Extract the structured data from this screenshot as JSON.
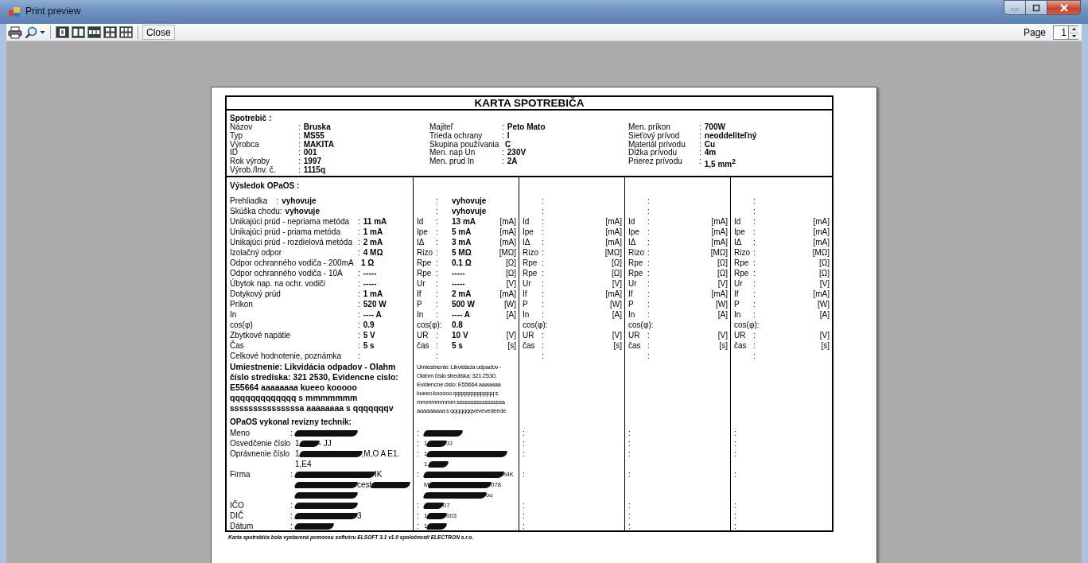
{
  "window": {
    "title": "Print preview"
  },
  "toolbar": {
    "close_button": "Close",
    "page_label": "Page",
    "page": "1"
  },
  "document": {
    "title": "KARTA SPOTREBIČA",
    "appliance": {
      "heading": "Spotrebič :",
      "groups": [
        [
          {
            "label": "Názov",
            "colon": ":",
            "value": "Bruska"
          },
          {
            "label": "Typ",
            "colon": ":",
            "value": "MS55"
          },
          {
            "label": "Výrobca",
            "colon": ":",
            "value": "MAKITA"
          },
          {
            "label": "ID",
            "colon": ":",
            "value": "001"
          },
          {
            "label": "Rok výroby",
            "colon": ":",
            "value": "1997"
          },
          {
            "label": "Výrob./Inv. č.",
            "colon": ":",
            "value": "1115q"
          }
        ],
        [
          {
            "label": "Majiteľ",
            "colon": ":",
            "value": "Peto Mato"
          },
          {
            "label": "Trieda ochrany",
            "colon": ":",
            "value": "I"
          },
          {
            "label": "Skupina používania",
            "value": "C"
          },
          {
            "label": "Men. nap Un",
            "colon": ":",
            "value": "230V"
          },
          {
            "label": "Men. prud In",
            "colon": ":",
            "value": "2A"
          }
        ],
        [
          {
            "label": "Men. príkon",
            "colon": ":",
            "value": "700W"
          },
          {
            "label": "Sieťový prívod",
            "colon": ":",
            "value": "neoddeliteľný"
          },
          {
            "label": "Materiál prívodu",
            "colon": ":",
            "value": "Cu"
          },
          {
            "label": "Dĺžka prívodu",
            "colon": ":",
            "value": "4m"
          },
          {
            "label": "Prierez prívodu",
            "colon": ":",
            "value": "1,5  mm$^{2}$"
          }
        ]
      ]
    },
    "results": {
      "heading": "Výsledok OPaOS :",
      "rows": [
        {
          "kind": "inline",
          "label": "Prehliadka    :",
          "value": "vyhovuje"
        },
        {
          "kind": "inline",
          "label": "Skúška chodu:",
          "value": "vyhovuje"
        },
        {
          "kind": "wide",
          "label": "Unikajúci prúd - nepriama metóda",
          "colon": ":",
          "value": "11 mA"
        },
        {
          "kind": "wide",
          "label": "Unikajúci prúd - priama metóda",
          "colon": ":",
          "value": "1 mA"
        },
        {
          "kind": "wide",
          "label": "Unikajúci prúd - rozdielová metóda",
          "colon": ":",
          "value": "2 mA"
        },
        {
          "kind": "wide",
          "label": "Izolačný odpor",
          "colon": ":",
          "value": "4 MΩ"
        },
        {
          "kind": "wide",
          "label": "Odpor ochranného vodiča - 200mA",
          "value": "1 Ω"
        },
        {
          "kind": "wide",
          "label": "Odpor ochranného vodiča - 10A",
          "colon": ":",
          "value": "-----"
        },
        {
          "kind": "wide",
          "label": "Úbytok nap. na ochr. vodiči",
          "colon": ":",
          "value": "-----"
        },
        {
          "kind": "wide",
          "label": "Dotykový prúd",
          "colon": ":",
          "value": "1 mA"
        },
        {
          "kind": "wide",
          "label": "Príkon",
          "colon": ":",
          "value": "520 W"
        },
        {
          "kind": "wide",
          "label": "In",
          "colon": ":",
          "value": "---- A"
        },
        {
          "kind": "wide",
          "label": "cos(φ)",
          "colon": ":",
          "value": "0.9"
        },
        {
          "kind": "wide",
          "label": "Zbytkové napätie",
          "colon": ":",
          "value": "5 V"
        },
        {
          "kind": "wide",
          "label": "Čas",
          "colon": ":",
          "value": "5 s"
        },
        {
          "kind": "wide",
          "label": "Celkové hodnotenie, poznámka",
          "colon": ":"
        }
      ],
      "note": "Umiestnenie: Likvidácia odpadov - Olahm číslo strediska: 321 2530, Evidencne cislo: E55664 aaaaaaaa kueeo  kooooo qqqqqqqqqqqqq s mmmmmmm sssssssssssssssa  aaaaaaaa s qqqqqqqv",
      "columns": [
        {
          "rows": [
            {
              "colon": ":",
              "value": "vyhovuje"
            },
            {
              "colon": ":",
              "value": "vyhovuje"
            },
            {
              "symbol": "Id",
              "colon": ":",
              "value": "13 mA",
              "unit": "[mA]"
            },
            {
              "symbol": "Ipe",
              "colon": ":",
              "value": "5 mA",
              "unit": "[mA]"
            },
            {
              "symbol": "IΔ",
              "colon": ":",
              "value": "3 mA",
              "unit": "[mA]"
            },
            {
              "symbol": "Rizo",
              "colon": ":",
              "value": "5 MΩ",
              "unit": "[MΩ]"
            },
            {
              "symbol": "Rpe",
              "colon": ":",
              "value": "0.1 Ω",
              "unit": "[Ω]"
            },
            {
              "symbol": "Rpe",
              "colon": ":",
              "value": "-----",
              "unit": "[Ω]"
            },
            {
              "symbol": "Ur",
              "colon": ":",
              "value": "-----",
              "unit": "[V]"
            },
            {
              "symbol": "If",
              "colon": ":",
              "value": "2 mA",
              "unit": "[mA]"
            },
            {
              "symbol": "P",
              "colon": ":",
              "value": "500 W",
              "unit": "[W]"
            },
            {
              "symbol": "In",
              "colon": ":",
              "value": "---- A",
              "unit": "[A]"
            },
            {
              "symbol": "cos(φ)",
              "colon": ":",
              "value": "0.8"
            },
            {
              "symbol": "UR",
              "colon": ":",
              "value": "10 V",
              "unit": "[V]"
            },
            {
              "symbol": "čas",
              "colon": ":",
              "value": "5 s",
              "unit": "[s]"
            },
            {
              "colon": ":"
            }
          ],
          "note": "Umiestnenie: Likvidácia odpadov - Olahm číslo strediska: 321 2530, Evidencne cislo: E55664  aaaaaaa kueeo  kooooo qqqqqqqqqqqqq s mmmmmmmm ssssssssssssssssa aaaaaaaaa s qqqqqqqvevevedeede"
        },
        {
          "rows": [
            {
              "colon": ":"
            },
            {
              "colon": ":"
            },
            {
              "symbol": "Id",
              "colon": ":",
              "unit": "[mA]"
            },
            {
              "symbol": "Ipe",
              "colon": ":",
              "unit": "[mA]"
            },
            {
              "symbol": "IΔ",
              "colon": ":",
              "unit": "[mA]"
            },
            {
              "symbol": "Rizo",
              "colon": ":",
              "unit": "[MΩ]"
            },
            {
              "symbol": "Rpe",
              "colon": ":",
              "unit": "[Ω]"
            },
            {
              "symbol": "Rpe",
              "colon": ":",
              "unit": "[Ω]"
            },
            {
              "symbol": "Ur",
              "colon": ":",
              "unit": "[V]"
            },
            {
              "symbol": "If",
              "colon": ":",
              "unit": "[mA]"
            },
            {
              "symbol": "P",
              "colon": ":",
              "unit": "[W]"
            },
            {
              "symbol": "In",
              "colon": ":",
              "unit": "[A]"
            },
            {
              "symbol": "cos(φ)",
              "colon": ":"
            },
            {
              "symbol": "UR",
              "colon": ":",
              "unit": "[V]"
            },
            {
              "symbol": "čas",
              "colon": ":",
              "unit": "[s]"
            },
            {
              "colon": ":"
            }
          ]
        },
        {
          "rows": [
            {
              "colon": ":"
            },
            {
              "colon": ":"
            },
            {
              "symbol": "Id",
              "colon": ":",
              "unit": "[mA]"
            },
            {
              "symbol": "Ipe",
              "colon": ":",
              "unit": "[mA]"
            },
            {
              "symbol": "IΔ",
              "colon": ":",
              "unit": "[mA]"
            },
            {
              "symbol": "Rizo",
              "colon": ":",
              "unit": "[MΩ]"
            },
            {
              "symbol": "Rpe",
              "colon": ":",
              "unit": "[Ω]"
            },
            {
              "symbol": "Rpe",
              "colon": ":",
              "unit": "[Ω]"
            },
            {
              "symbol": "Ur",
              "colon": ":",
              "unit": "[V]"
            },
            {
              "symbol": "If",
              "colon": ":",
              "unit": "[mA]"
            },
            {
              "symbol": "P",
              "colon": ":",
              "unit": "[W]"
            },
            {
              "symbol": "In",
              "colon": ":",
              "unit": "[A]"
            },
            {
              "symbol": "cos(φ)",
              "colon": ":"
            },
            {
              "symbol": "UR",
              "colon": ":",
              "unit": "[V]"
            },
            {
              "symbol": "čas",
              "colon": ":",
              "unit": "[s]"
            },
            {
              "colon": ":"
            }
          ]
        },
        {
          "rows": [
            {
              "colon": ":"
            },
            {
              "colon": ":"
            },
            {
              "symbol": "Id",
              "colon": ":",
              "unit": "[mA]"
            },
            {
              "symbol": "Ipe",
              "colon": ":",
              "unit": "[mA]"
            },
            {
              "symbol": "IΔ",
              "colon": ":",
              "unit": "[mA]"
            },
            {
              "symbol": "Rizo",
              "colon": ":",
              "unit": "[MΩ]"
            },
            {
              "symbol": "Rpe",
              "colon": ":",
              "unit": "[Ω]"
            },
            {
              "symbol": "Rpe",
              "colon": ":",
              "unit": "[Ω]"
            },
            {
              "symbol": "Ur",
              "colon": ":",
              "unit": "[V]"
            },
            {
              "symbol": "If",
              "colon": ":",
              "unit": "[mA]"
            },
            {
              "symbol": "P",
              "colon": ":",
              "unit": "[W]"
            },
            {
              "symbol": "In",
              "colon": ":",
              "unit": "[A]"
            },
            {
              "symbol": "cos(φ)",
              "colon": ":"
            },
            {
              "symbol": "UR",
              "colon": ":",
              "unit": "[V]"
            },
            {
              "symbol": "čas",
              "colon": ":",
              "unit": "[s]"
            },
            {
              "colon": ":"
            }
          ]
        }
      ]
    },
    "technician": {
      "title": "OPaOS vykonal revízny technik:",
      "rows": [
        {
          "label": "Meno",
          "colon": ":",
          "lines": [
            [
              {
                "kind": "longblot"
              }
            ]
          ]
        },
        {
          "label": "Osvedčenie číslo",
          "lines": [
            [
              {
                "kind": "text",
                "text": "1"
              },
              {
                "kind": "shortblot"
              },
              {
                "kind": "text",
                "text": " - JJ"
              }
            ]
          ]
        },
        {
          "label": "Oprávnenie číslo",
          "lines": [
            [
              {
                "kind": "text",
                "text": "1"
              },
              {
                "kind": "longblot"
              },
              {
                "kind": "text",
                "text": ",M,O A E1."
              }
            ],
            [
              {
                "kind": "text",
                "text": "1,E4"
              }
            ]
          ]
        },
        {
          "label": "Firma",
          "colon": ":",
          "lines": [
            [
              {
                "kind": "widerblot"
              },
              {
                "kind": "text",
                "text": "IK"
              }
            ],
            [
              {
                "kind": "longblot"
              },
              {
                "kind": "text",
                "text": "cest"
              },
              {
                "kind": "blot"
              }
            ],
            [
              {
                "kind": "longblot"
              }
            ]
          ]
        },
        {
          "label": "IČO",
          "colon": ":",
          "lines": [
            [
              {
                "kind": "longblot"
              }
            ]
          ]
        },
        {
          "label": "DIČ",
          "colon": ":",
          "lines": [
            [
              {
                "kind": "longblot"
              },
              {
                "kind": "text",
                "text": "3"
              }
            ]
          ]
        },
        {
          "label": "Dátum",
          "colon": ":",
          "lines": [
            [
              {
                "kind": "blot"
              }
            ]
          ]
        }
      ],
      "columns": [
        {
          "rows": [
            {
              "colon": ":",
              "lines": [
                [
                  {
                    "kind": "blot"
                  }
                ]
              ]
            },
            {
              "colon": ":",
              "lines": [
                [
                  {
                    "kind": "text",
                    "text": "1"
                  },
                  {
                    "kind": "shortblot"
                  },
                  {
                    "kind": "text",
                    "text": " JJ"
                  }
                ]
              ]
            },
            {
              "colon": ":",
              "lines": [
                [
                  {
                    "kind": "text",
                    "text": "1"
                  },
                  {
                    "kind": "widerblot"
                  }
                ],
                [
                  {
                    "kind": "text",
                    "text": "1,"
                  },
                  {
                    "kind": "shortblot"
                  }
                ]
              ]
            },
            {
              "colon": ":",
              "lines": [
                [
                  {
                    "kind": "widerblot"
                  },
                  {
                    "kind": "text",
                    "text": "NIK"
                  }
                ],
                [
                  {
                    "kind": "text",
                    "text": "M"
                  },
                  {
                    "kind": "longblot"
                  },
                  {
                    "kind": "text",
                    "text": "078"
                  }
                ],
                [
                  {
                    "kind": "longblot"
                  },
                  {
                    "kind": "text",
                    "text": "ou"
                  }
                ]
              ]
            },
            {
              "colon": ":",
              "lines": [
                [
                  {
                    "kind": "shortblot"
                  },
                  {
                    "kind": "text",
                    "text": "07"
                  }
                ]
              ]
            },
            {
              "colon": ":",
              "lines": [
                [
                  {
                    "kind": "text",
                    "text": "1"
                  },
                  {
                    "kind": "shortblot"
                  },
                  {
                    "kind": "text",
                    "text": "003"
                  }
                ]
              ]
            },
            {
              "colon": ":",
              "lines": [
                [
                  {
                    "kind": "text",
                    "text": "1"
                  },
                  {
                    "kind": "shortblot"
                  }
                ]
              ]
            }
          ]
        },
        {
          "rows": [
            {
              "colon": ":"
            },
            {
              "colon": ":"
            },
            {
              "colon": ":"
            },
            {
              "colon": ":"
            },
            {
              "colon": ":"
            },
            {
              "colon": ":"
            },
            {
              "colon": ":"
            }
          ]
        },
        {
          "rows": [
            {
              "colon": ":"
            },
            {
              "colon": ":"
            },
            {
              "colon": ":"
            },
            {
              "colon": ":"
            },
            {
              "colon": ":"
            },
            {
              "colon": ":"
            },
            {
              "colon": ":"
            }
          ]
        },
        {
          "rows": [
            {
              "colon": ":"
            },
            {
              "colon": ":"
            },
            {
              "colon": ":"
            },
            {
              "colon": ":"
            },
            {
              "colon": ":"
            },
            {
              "colon": ":"
            },
            {
              "colon": ":"
            }
          ]
        }
      ]
    },
    "footer": "Karta spotrebiča bola vystavená pomocou softvéru ELSOFT 3.1 v1.0 spoločnosti ELECTRON s.r.o."
  }
}
